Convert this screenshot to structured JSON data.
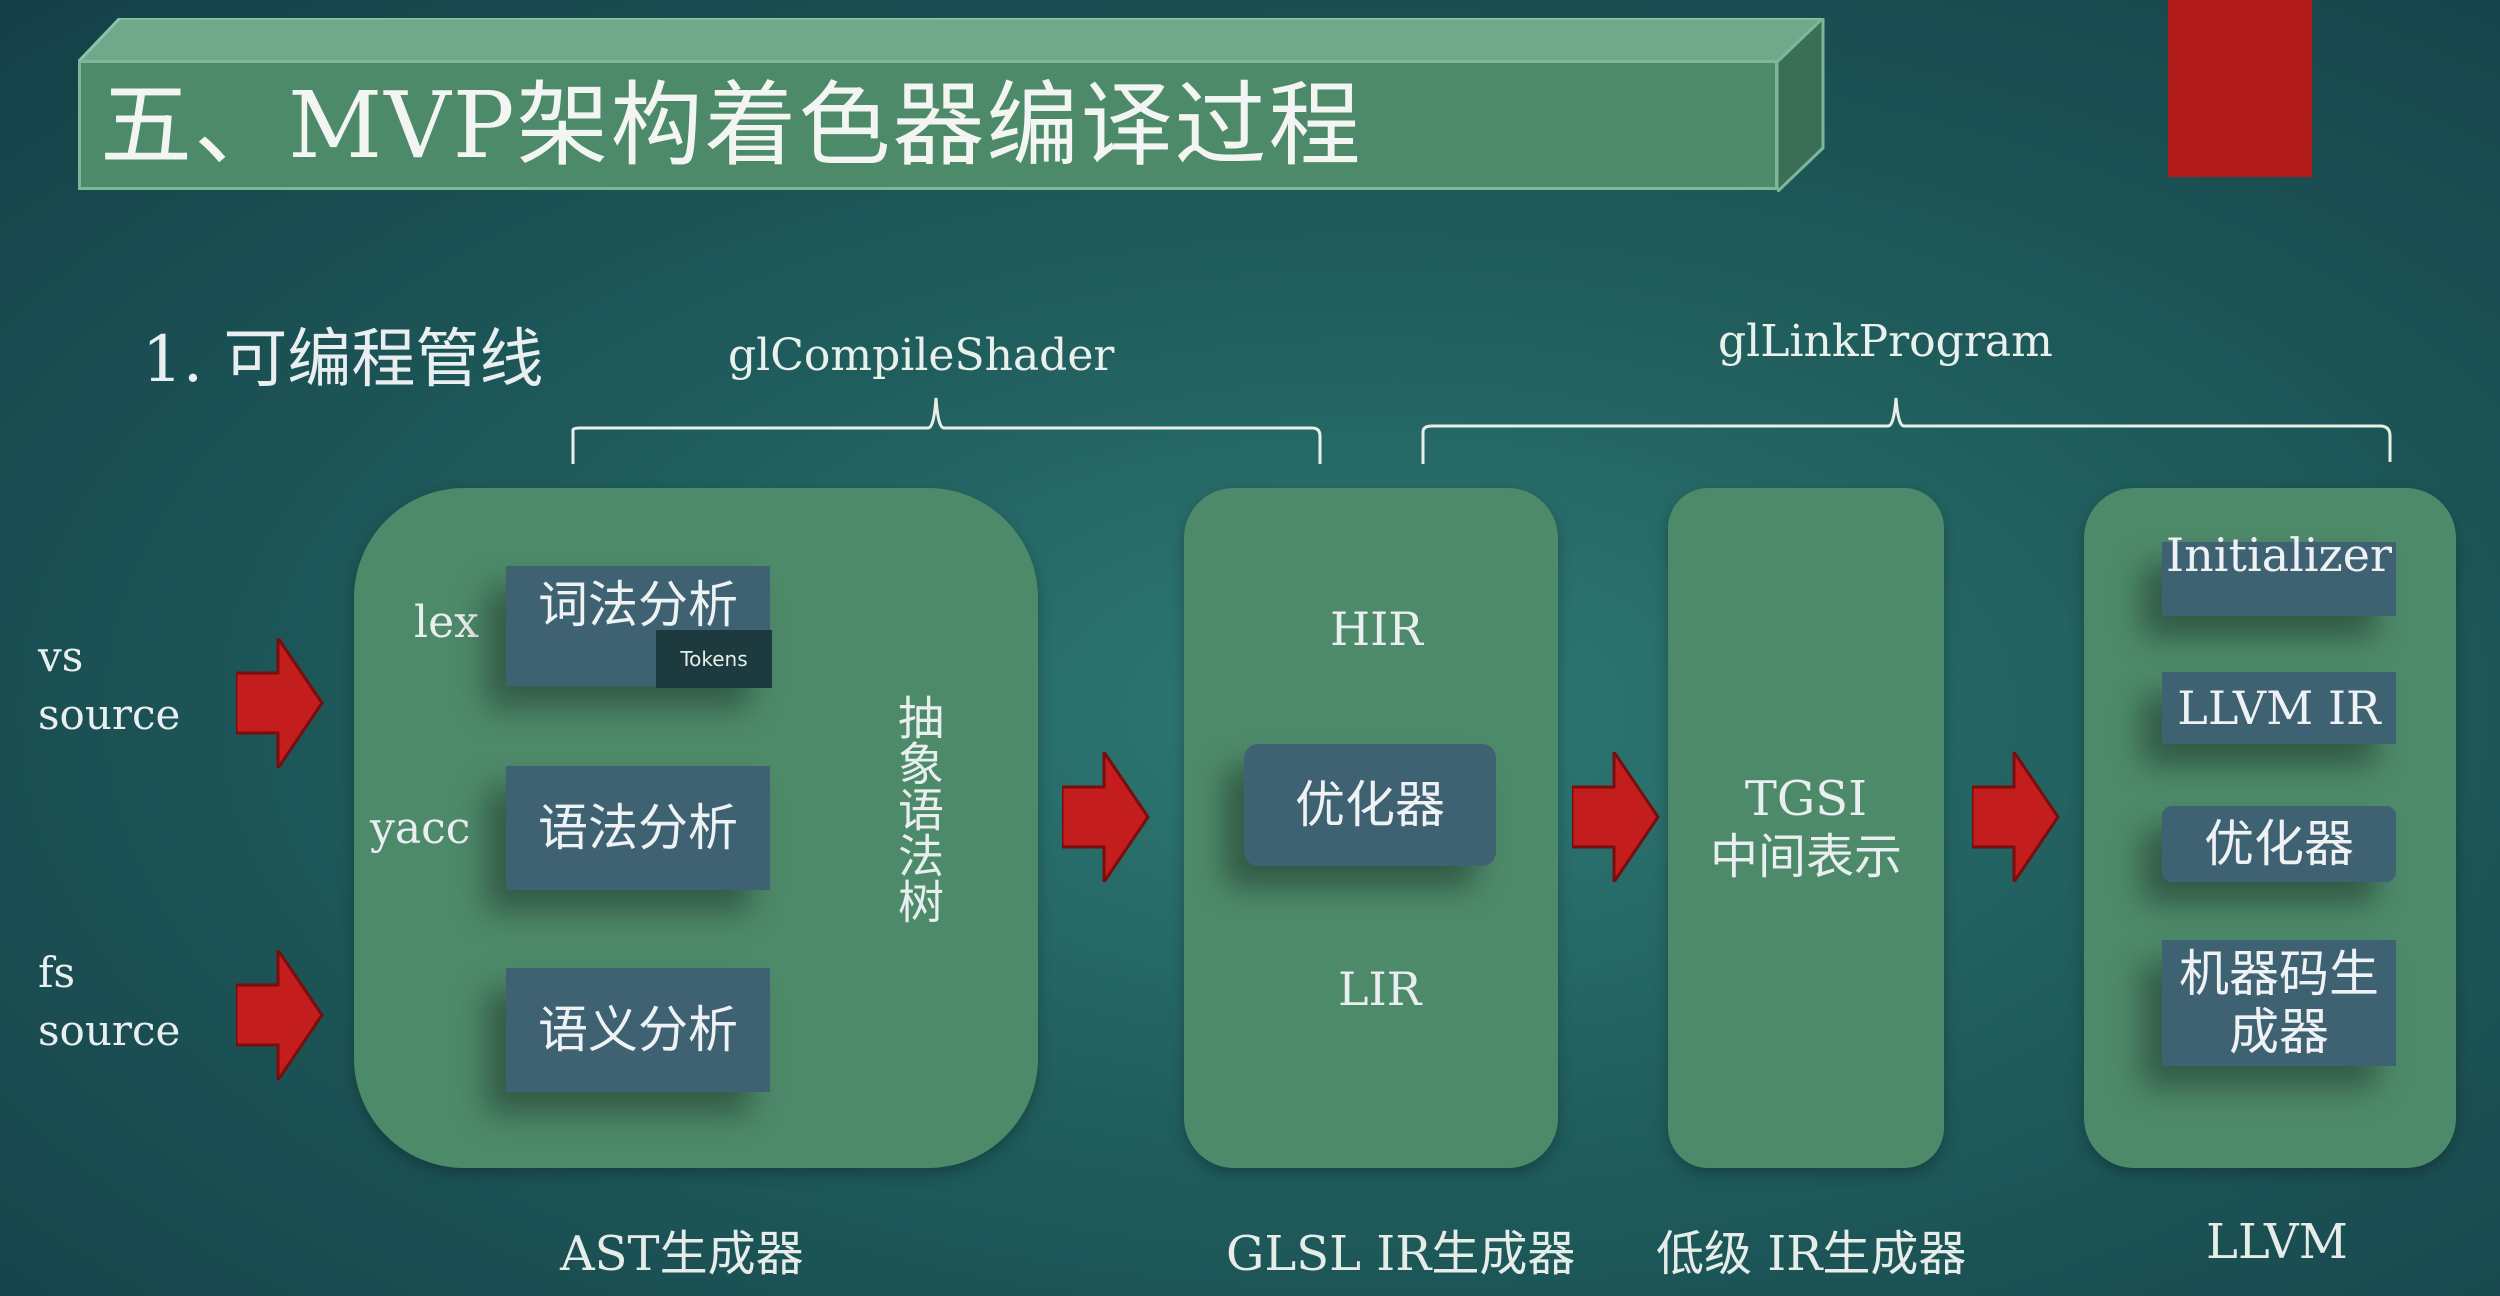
{
  "title": "五、MVP架构着色器编译过程",
  "subtitle": "1. 可编程管线",
  "stages": {
    "compile": "glCompileShader",
    "link": "glLinkProgram"
  },
  "inputs": {
    "vs": [
      "vs",
      "source"
    ],
    "fs": [
      "fs",
      "source"
    ]
  },
  "ast": {
    "lex": "lex",
    "yacc": "yacc",
    "lexical": "词法分析",
    "tokens": "Tokens",
    "syntax": "语法分析",
    "semantic": "语义分析",
    "ast_vertical": "抽象语法树",
    "caption": "AST生成器"
  },
  "glsl_ir": {
    "hir": "HIR",
    "optimizer": "优化器",
    "lir": "LIR",
    "caption": "GLSL IR生成器"
  },
  "low_ir": {
    "tgsi": "TGSI",
    "middle": "中间表示",
    "caption": "低级 IR生成器"
  },
  "llvm": {
    "initializer": "Initializer",
    "llvm_ir": "LLVM IR",
    "optimizer": "优化器",
    "codegen": "机器码生成器",
    "caption": "LLVM"
  },
  "colors": {
    "panel": "#4d8a6a",
    "box": "#3e6272",
    "arrow": "#c41d1d",
    "accent_block": "#b11a1a"
  }
}
